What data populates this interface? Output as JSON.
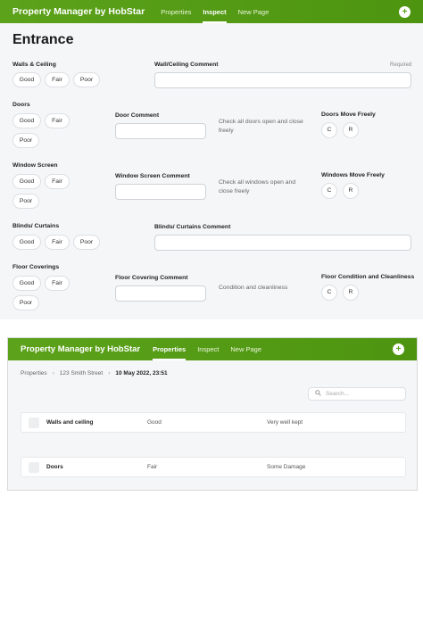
{
  "panel1": {
    "nav": {
      "brand": "Property Manager by HobStar",
      "links": [
        "Properties",
        "Inspect",
        "New Page"
      ],
      "active": "Inspect",
      "plus": "+"
    },
    "title": "Entrance",
    "required": "Required",
    "sections": [
      {
        "label": "Walls & Ceiling",
        "options": [
          "Good",
          "Fair",
          "Poor"
        ],
        "comment_label": "Wall/Ceiling Comment"
      },
      {
        "label": "Doors",
        "options": [
          "Good",
          "Fair",
          "Poor"
        ],
        "comment_label": "Door Comment",
        "hint": "Check all doors open and close freely",
        "side_label": "Doors Move Freely",
        "side_options": [
          "C",
          "R"
        ]
      },
      {
        "label": "Window Screen",
        "options": [
          "Good",
          "Fair",
          "Poor"
        ],
        "comment_label": "Window Screen Comment",
        "hint": "Check all windows open and close freely",
        "side_label": "Windows Move Freely",
        "side_options": [
          "C",
          "R"
        ]
      },
      {
        "label": "Blinds/ Curtains",
        "options": [
          "Good",
          "Fair",
          "Poor"
        ],
        "comment_label": "Blinds/ Curtains Comment"
      },
      {
        "label": "Floor Coverings",
        "options": [
          "Good",
          "Fair",
          "Poor"
        ],
        "comment_label": "Floor Covering Comment",
        "hint": "Condition and cleanliness",
        "side_label": "Floor Condition and Cleanliness",
        "side_options": [
          "C",
          "R"
        ]
      }
    ]
  },
  "panel2": {
    "nav": {
      "brand": "Property Manager by HobStar",
      "links": [
        "Properties",
        "Inspect",
        "New Page"
      ],
      "active": "Properties",
      "plus": "+"
    },
    "breadcrumb": [
      "Properties",
      "123 Smith Street",
      "10 May 2022, 23:51"
    ],
    "search_placeholder": "Search...",
    "rows": [
      {
        "name": "Walls and ceiling",
        "rating": "Good",
        "comment": "Very well kept"
      },
      {
        "name": "Doors",
        "rating": "Fair",
        "comment": "Some Damage"
      }
    ]
  },
  "colors": {
    "nav_green": "#5ca21a",
    "page_bg": "#f5f6f7"
  },
  "icons": {
    "search": "search-icon",
    "add": "plus-icon",
    "separator": "chevron-right-icon"
  }
}
